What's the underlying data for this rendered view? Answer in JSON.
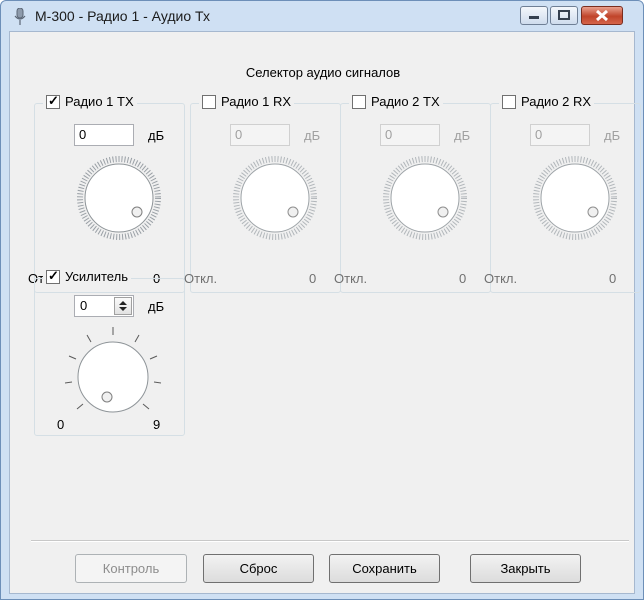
{
  "window": {
    "title": "М-300 - Радио 1 - Аудио Тх",
    "icon": "microphone-icon",
    "controls": [
      "minimize-icon",
      "maximize-icon",
      "close-icon"
    ]
  },
  "selector": {
    "title": "Селектор аудио сигналов",
    "channels": [
      {
        "label": "Радио 1 TX",
        "checked": true,
        "value": "0",
        "unit": "дБ",
        "min_label": "Откл.",
        "max_label": "0",
        "enabled": true
      },
      {
        "label": "Радио 1 RX",
        "checked": false,
        "value": "0",
        "unit": "дБ",
        "min_label": "Откл.",
        "max_label": "0",
        "enabled": false
      },
      {
        "label": "Радио 2 TX",
        "checked": false,
        "value": "0",
        "unit": "дБ",
        "min_label": "Откл.",
        "max_label": "0",
        "enabled": false
      },
      {
        "label": "Радио 2 RX",
        "checked": false,
        "value": "0",
        "unit": "дБ",
        "min_label": "Откл.",
        "max_label": "0",
        "enabled": false
      }
    ]
  },
  "amplifier": {
    "label": "Усилитель",
    "checked": true,
    "value": "0",
    "unit": "дБ",
    "min_label": "0",
    "max_label": "9"
  },
  "buttons": {
    "control": "Контроль",
    "reset": "Сброс",
    "save": "Сохранить",
    "close": "Закрыть"
  }
}
